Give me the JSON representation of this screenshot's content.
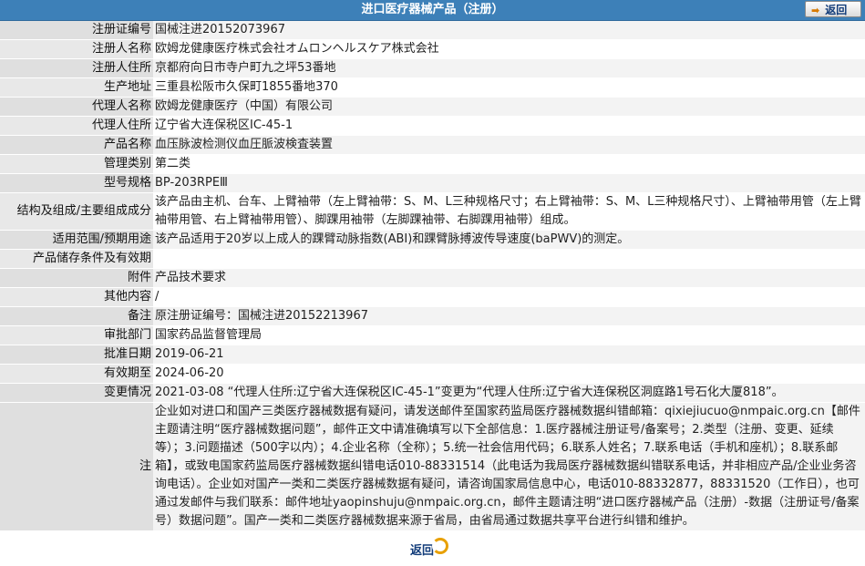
{
  "header": {
    "title": "进口医疗器械产品（注册）",
    "back_label": "返回"
  },
  "rows": [
    {
      "label": "注册证编号",
      "value": "国械注进20152073967"
    },
    {
      "label": "注册人名称",
      "value": "欧姆龙健康医疗株式会社オムロンヘルスケア株式会社"
    },
    {
      "label": "注册人住所",
      "value": "京都府向日市寺户町九之坪53番地"
    },
    {
      "label": "生产地址",
      "value": "三重县松阪市久保町1855番地370"
    },
    {
      "label": "代理人名称",
      "value": "欧姆龙健康医疗（中国）有限公司"
    },
    {
      "label": "代理人住所",
      "value": "辽宁省大连保税区IC-45-1"
    },
    {
      "label": "产品名称",
      "value": "血压脉波检测仪血圧脈波検査装置"
    },
    {
      "label": "管理类别",
      "value": "第二类"
    },
    {
      "label": "型号规格",
      "value": "BP-203RPEⅢ"
    },
    {
      "label": "结构及组成/主要组成成分",
      "value": "该产品由主机、台车、上臂袖带（左上臂袖带：S、M、L三种规格尺寸；右上臂袖带：S、M、L三种规格尺寸）、上臂袖带用管（左上臂袖带用管、右上臂袖带用管）、脚踝用袖带（左脚踝袖带、右脚踝用袖带）组成。"
    },
    {
      "label": "适用范围/预期用途",
      "value": "该产品适用于20岁以上成人的踝臂动脉指数(ABI)和踝臂脉搏波传导速度(baPWV)的测定。"
    },
    {
      "label": "产品储存条件及有效期",
      "value": ""
    },
    {
      "label": "附件",
      "value": "产品技术要求"
    },
    {
      "label": "其他内容",
      "value": "/"
    },
    {
      "label": "备注",
      "value": "原注册证编号：国械注进20152213967"
    },
    {
      "label": "审批部门",
      "value": "国家药品监督管理局"
    },
    {
      "label": "批准日期",
      "value": "2019-06-21"
    },
    {
      "label": "有效期至",
      "value": "2024-06-20"
    },
    {
      "label": "变更情况",
      "value": "2021-03-08 “代理人住所:辽宁省大连保税区IC-45-1”变更为“代理人住所:辽宁省大连保税区洞庭路1号石化大厦818”。"
    },
    {
      "label": "注",
      "value": "企业如对进口和国产三类医疗器械数据有疑问，请发送邮件至国家药监局医疗器械数据纠错邮箱：qixiejiucuo@nmpaic.org.cn【邮件主题请注明“医疗器械数据问题”，邮件正文中请准确填写以下全部信息：1.医疗器械注册证号/备案号；2.类型（注册、变更、延续等）；3.问题描述（500字以内）；4.企业名称（全称）；5.统一社会信用代码；6.联系人姓名；7.联系电话（手机和座机）；8.联系邮箱】，或致电国家药监局医疗器械数据纠错电话010-88331514（此电话为我局医疗器械数据纠错联系电话，并非相应产品/企业业务咨询电话）。企业如对国产一类和二类医疗器械数据有疑问，请咨询国家局信息中心，电话010-88332877，88331520（工作日），也可通过发邮件与我们联系：邮件地址yaopinshuju@nmpaic.org.cn，邮件主题请注明“进口医疗器械产品（注册）-数据（注册证号/备案号）数据问题”。国产一类和二类医疗器械数据来源于省局，由省局通过数据共享平台进行纠错和维护。"
    }
  ],
  "footer": {
    "back_label": "返回"
  }
}
